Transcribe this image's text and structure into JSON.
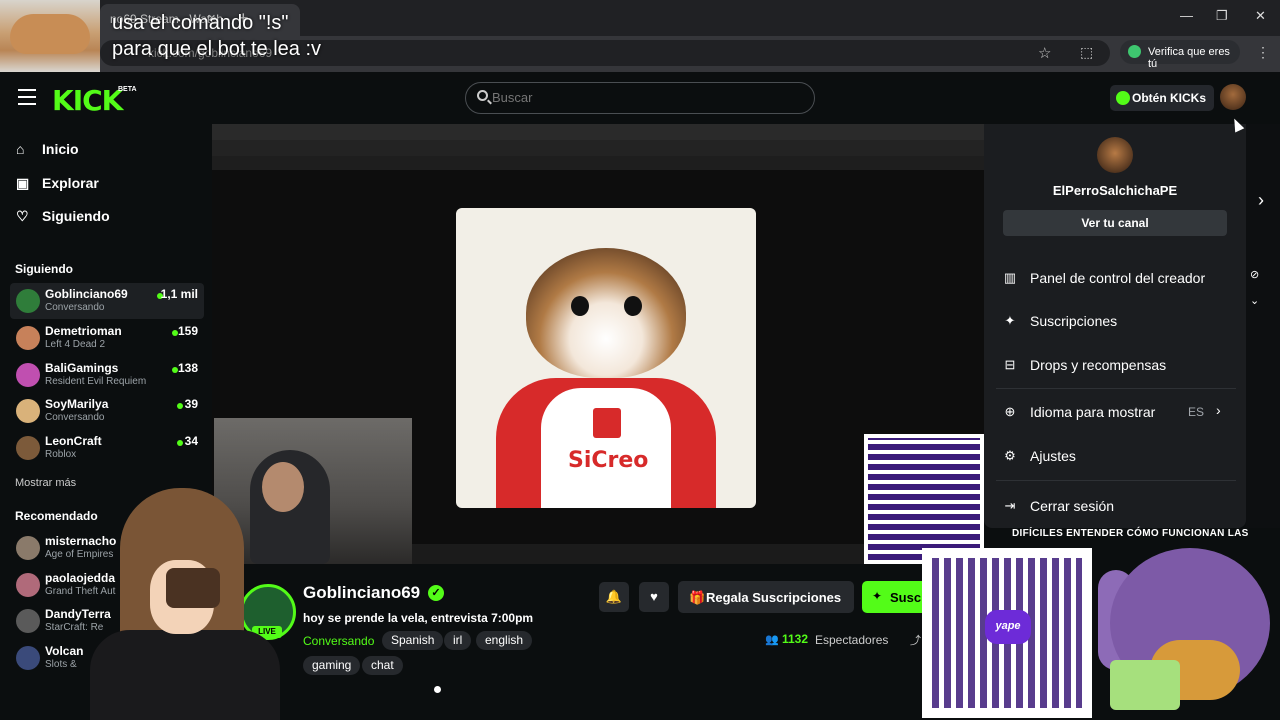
{
  "browser": {
    "tab_title": "no69 Stream - Watch",
    "tab_close": "×",
    "new_tab": "+",
    "url_partial": "kick.com/goblinciano69",
    "verify_label": "Verifica que eres tú",
    "win_minimize": "—",
    "win_restore": "❐",
    "win_close": "✕",
    "star_icon": "☆",
    "extensions_icon": "⬚",
    "more_icon": "⋮"
  },
  "overlay_caption": {
    "line1": "usa el comando \"!s\"",
    "line2": "para que el bot te lea :v"
  },
  "header": {
    "logo": "KICK",
    "beta": "BETA",
    "search_placeholder": "Buscar",
    "kicks_button": "Obtén KICKs"
  },
  "sidebar": {
    "nav": [
      {
        "label": "Inicio",
        "icon": "⌂"
      },
      {
        "label": "Explorar",
        "icon": "▣"
      },
      {
        "label": "Siguiendo",
        "icon": "♡"
      }
    ],
    "following_title": "Siguiendo",
    "following": [
      {
        "name": "Goblinciano69",
        "game": "Conversando",
        "count": "1,1 mil",
        "color": "#2f7d3a"
      },
      {
        "name": "Demetrioman",
        "game": "Left 4 Dead 2",
        "count": "159",
        "color": "#c7815a"
      },
      {
        "name": "BaliGamings",
        "game": "Resident Evil Requiem",
        "count": "138",
        "color": "#c04fb0"
      },
      {
        "name": "SoyMarilya",
        "game": "Conversando",
        "count": "39",
        "color": "#d9b27a"
      },
      {
        "name": "LeonCraft",
        "game": "Roblox",
        "count": "34",
        "color": "#7c5a3a"
      }
    ],
    "show_more": "Mostrar más",
    "recommended_title": "Recomendado",
    "recommended": [
      {
        "name": "misternacho",
        "game": "Age of Empires",
        "color": "#8a7a6a"
      },
      {
        "name": "paolaojedda",
        "game": "Grand Theft Aut",
        "color": "#b06a7a"
      },
      {
        "name": "DandyTerra",
        "game": "StarCraft: Re",
        "color": "#5a5a5a"
      },
      {
        "name": "Volcan",
        "game": "Slots &",
        "color": "#3a4a7a"
      }
    ]
  },
  "video": {
    "brand_text": "SiCreo"
  },
  "dropdown": {
    "username": "ElPerroSalchichaPE",
    "channel_button": "Ver tu canal",
    "items": [
      {
        "label": "Panel de control del creador",
        "icon": "▥"
      },
      {
        "label": "Suscripciones",
        "icon": "✦"
      },
      {
        "label": "Drops y recompensas",
        "icon": "⊟"
      },
      {
        "label": "Idioma para mostrar",
        "icon": "⊕"
      },
      {
        "label": "Ajustes",
        "icon": "⚙"
      },
      {
        "label": "Cerrar sesión",
        "icon": "⇥"
      }
    ],
    "language_value": "ES",
    "language_chevron": "›"
  },
  "right_edge": {
    "next_chevron": "›",
    "icon1": "⊘",
    "icon2": "⌄"
  },
  "ticker": "DIFÍCILES ENTENDER CÓMO FUNCIONAN LAS",
  "channel": {
    "name": "Goblinciano69",
    "live_badge": "LIVE",
    "verified": "✓",
    "title": "hoy se prende la vela, entrevista 7:00pm",
    "category": "Conversando",
    "tags": [
      "Spanish",
      "irl",
      "english",
      "gaming",
      "chat"
    ],
    "bell_icon": "🔔",
    "heart_icon": "♥",
    "gift_label": "Regala Suscripciones",
    "gift_icon": "🎁",
    "subscribe_label": "Suscribirse",
    "subscribe_icon": "✦",
    "viewers_count": "1132",
    "viewers_label": "Espectadores",
    "viewers_icon": "👥",
    "share_icon": "⤴"
  },
  "qr": {
    "logo_text": "yape"
  }
}
